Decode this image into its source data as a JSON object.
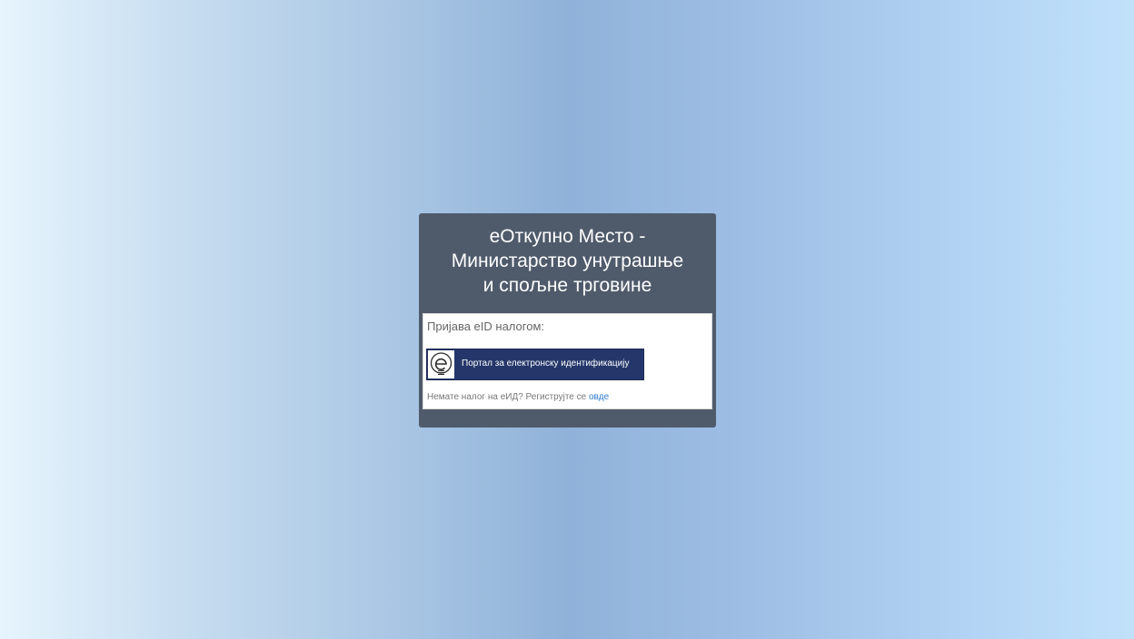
{
  "panel": {
    "title": "еОткупно Место -\nМинистарство унутрашње\nи спољне трговине"
  },
  "login": {
    "eid_label": "Пријава eID налогом:",
    "eid_button_label": "Портал за електронску идентификацију",
    "eid_logo_icon": "eid-e-logo-icon",
    "register_text": "Немате налог на еИД? Региструјте се ",
    "register_link": "овде"
  },
  "colors": {
    "panel_bg": "#4f5b6b",
    "button_bg": "#25376a",
    "link": "#2f7ad3"
  }
}
